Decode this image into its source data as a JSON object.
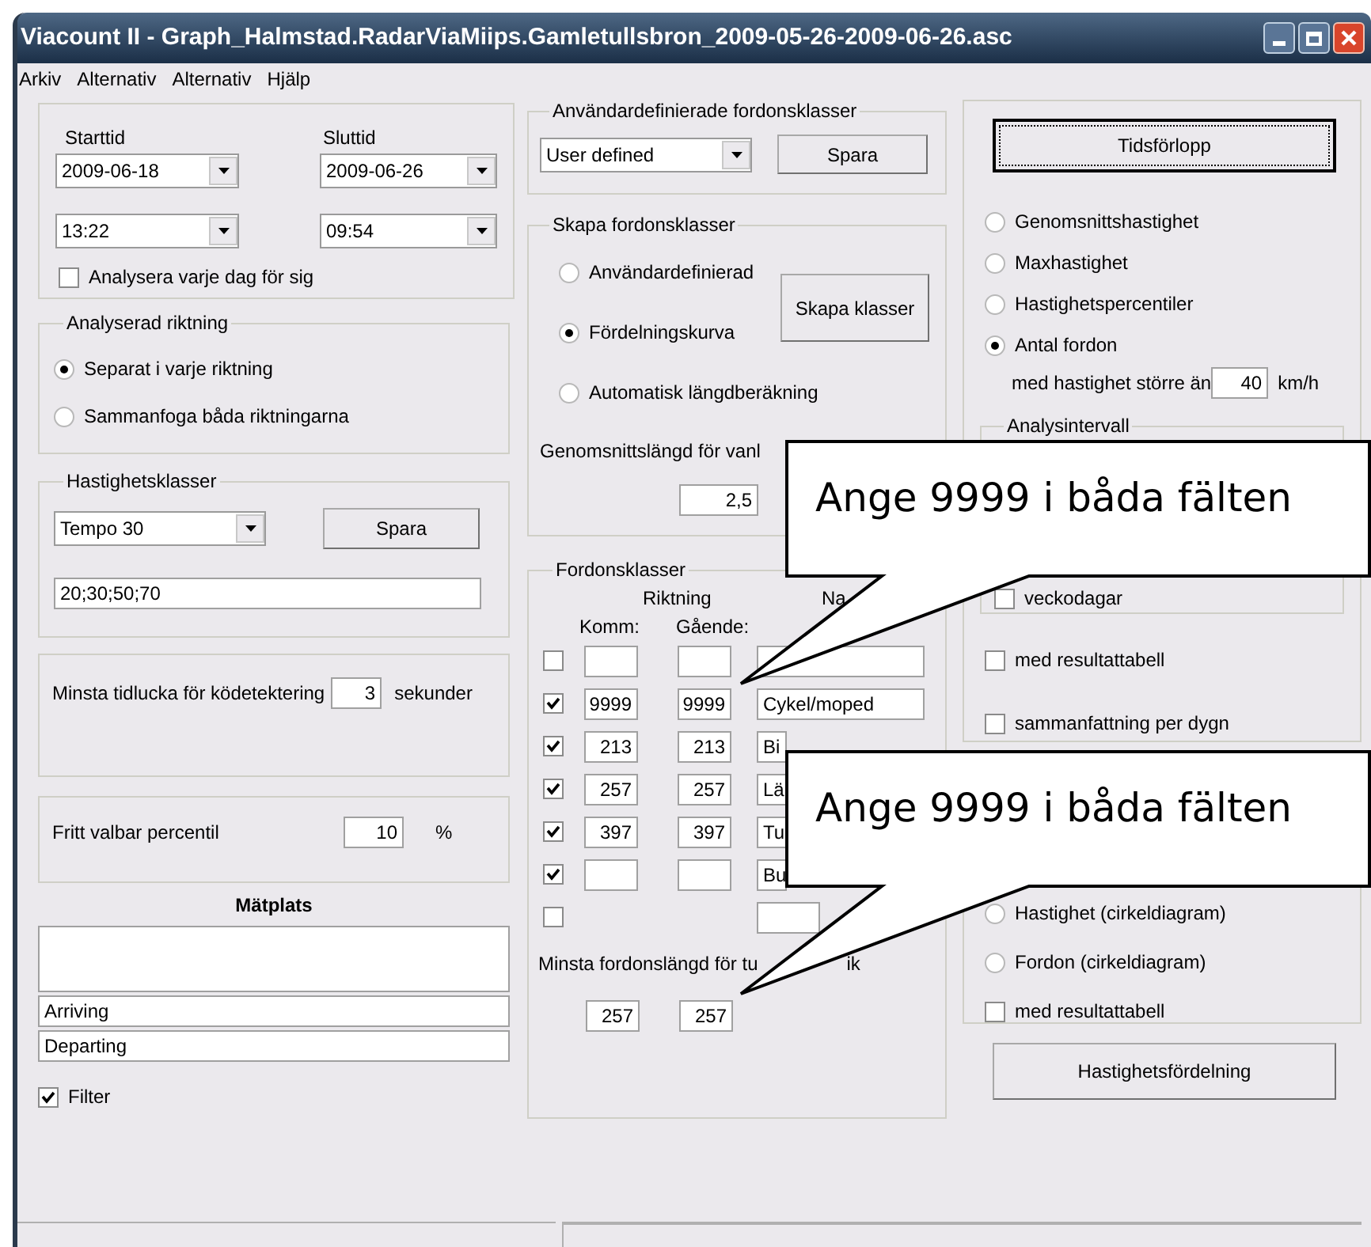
{
  "window": {
    "title": "Viacount II - Graph_Halmstad.RadarViaMiips.Gamletullsbron_2009-05-26-2009-06-26.asc"
  },
  "menu": [
    "Arkiv",
    "Alternativ",
    "Alternativ",
    "Hjälp"
  ],
  "period": {
    "start_label": "Starttid",
    "end_label": "Sluttid",
    "start_date": "2009-06-18",
    "end_date": "2009-06-26",
    "start_time": "13:22",
    "end_time": "09:54",
    "each_day": {
      "label": "Analysera varje dag för sig",
      "checked": false
    }
  },
  "direction": {
    "title": "Analyserad riktning",
    "options": [
      {
        "label": "Separat i varje riktning",
        "selected": true
      },
      {
        "label": "Sammanfoga båda riktningarna",
        "selected": false
      }
    ]
  },
  "speed_classes": {
    "title": "Hastighetsklasser",
    "preset": "Tempo  30",
    "save": "Spara",
    "value": "20;30;50;70"
  },
  "queue": {
    "label": "Minsta tidlucka för ködetektering",
    "value": "3",
    "unit": "sekunder"
  },
  "percentile": {
    "label": "Fritt valbar percentil",
    "value": "10",
    "unit": "%"
  },
  "site": {
    "title": "Mätplats",
    "arriving": "Arriving",
    "departing": "Departing",
    "filter": {
      "label": "Filter",
      "checked": true
    }
  },
  "user_classes": {
    "title": "Användardefinierade fordonsklasser",
    "preset": "User defined",
    "save": "Spara"
  },
  "create_classes": {
    "title": "Skapa fordonsklasser",
    "options": [
      {
        "label": "Användardefinierad",
        "selected": false
      },
      {
        "label": "Fördelningskurva",
        "selected": true
      },
      {
        "label": "Automatisk längdberäkning",
        "selected": false
      }
    ],
    "button": "Skapa klasser",
    "avg_length_label": "Genomsnittslängd för vanl",
    "avg_length": "2,5"
  },
  "vehicle_classes": {
    "title": "Fordonsklasser",
    "direction_label": "Riktning",
    "col_komm": "Komm:",
    "col_gaende": "Gående:",
    "col_name": "Na",
    "rows": [
      {
        "kind": "full",
        "checked": false
      },
      {
        "kind": "full",
        "checked": true,
        "komm": "9999",
        "gaende": "9999",
        "name": "Cykel/moped"
      },
      {
        "kind": "full",
        "checked": true,
        "komm": "213",
        "gaende": "213",
        "name": "Bi"
      },
      {
        "kind": "full",
        "checked": true,
        "komm": "257",
        "gaende": "257",
        "name": "Lä"
      },
      {
        "kind": "full",
        "checked": true,
        "komm": "397",
        "gaende": "397",
        "name": "Tu"
      },
      {
        "kind": "full",
        "checked": true,
        "name": "Bu"
      },
      {
        "kind": "name_only",
        "checked": false
      }
    ],
    "min_length": {
      "label": "Minsta fordonslängd för tu",
      "label_end": "ik",
      "komm": "257",
      "gaende": "257"
    }
  },
  "outputs": {
    "timeline_button": "Tidsförlopp",
    "measures": [
      {
        "label": "Genomsnittshastighet",
        "selected": false
      },
      {
        "label": "Maxhastighet",
        "selected": false
      },
      {
        "label": "Hastighetspercentiler",
        "selected": false
      },
      {
        "label": "Antal fordon",
        "selected": true
      }
    ],
    "threshold": {
      "label": "med hastighet större än",
      "value": "40",
      "unit": "km/h"
    },
    "interval": {
      "title": "Analysintervall",
      "options": [
        {
          "label": "veckodagar",
          "checked": false
        }
      ]
    },
    "checks": [
      {
        "label": "med resultattabell",
        "checked": false
      },
      {
        "label": "sammanfattning per dygn",
        "checked": false
      }
    ],
    "pie": [
      {
        "kind": "radio",
        "label": "Hastighet (cirkeldiagram)",
        "selected": false
      },
      {
        "kind": "radio",
        "label": "Fordon (cirkeldiagram)",
        "selected": false
      },
      {
        "kind": "checkbox",
        "label": "med resultattabell",
        "checked": false
      }
    ],
    "distribution_button": "Hastighetsfördelning"
  },
  "callouts": [
    {
      "text": "Ange 9999 i båda fälten"
    },
    {
      "text": "Ange 9999 i båda fälten"
    }
  ]
}
